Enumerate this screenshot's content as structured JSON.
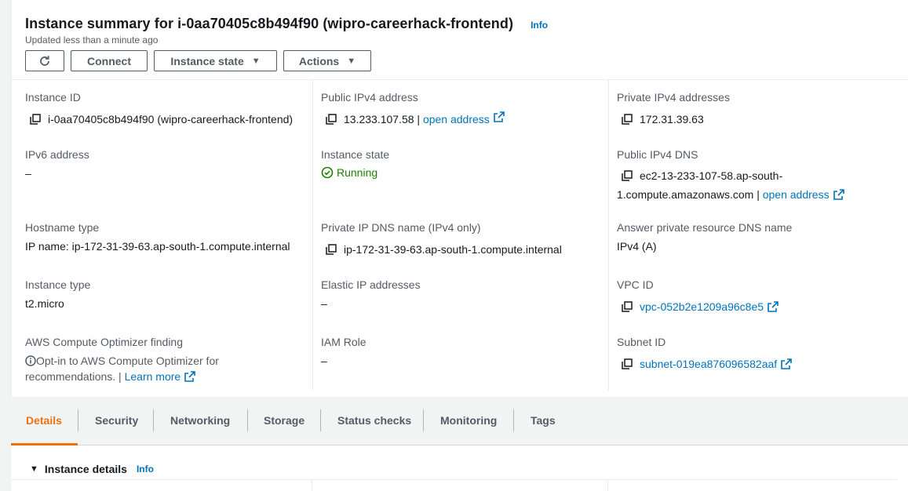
{
  "header": {
    "title": "Instance summary for i-0aa70405c8b494f90 (wipro-careerhack-frontend)",
    "info": "Info",
    "updated": "Updated less than a minute ago",
    "buttons": {
      "connect": "Connect",
      "instance_state": "Instance state",
      "actions": "Actions"
    }
  },
  "summary": {
    "instance_id": {
      "label": "Instance ID",
      "value": "i-0aa70405c8b494f90 (wipro-careerhack-frontend)"
    },
    "public_ipv4": {
      "label": "Public IPv4 address",
      "value": "13.233.107.58 |",
      "link": "open address"
    },
    "private_ipv4": {
      "label": "Private IPv4 addresses",
      "value": "172.31.39.63"
    },
    "ipv6": {
      "label": "IPv6 address",
      "value": "–"
    },
    "instance_state": {
      "label": "Instance state",
      "value": "Running"
    },
    "public_dns": {
      "label": "Public IPv4 DNS",
      "value_line1": "ec2-13-233-107-58.ap-south-",
      "value_line2": "1.compute.amazonaws.com |",
      "link": "open address"
    },
    "hostname_type": {
      "label": "Hostname type",
      "value": "IP name: ip-172-31-39-63.ap-south-1.compute.internal"
    },
    "private_dns": {
      "label": "Private IP DNS name (IPv4 only)",
      "value": "ip-172-31-39-63.ap-south-1.compute.internal"
    },
    "answer_dns": {
      "label": "Answer private resource DNS name",
      "value": "IPv4 (A)"
    },
    "instance_type": {
      "label": "Instance type",
      "value": "t2.micro"
    },
    "elastic_ip": {
      "label": "Elastic IP addresses",
      "value": "–"
    },
    "vpc_id": {
      "label": "VPC ID",
      "value": "vpc-052b2e1209a96c8e5"
    },
    "optimizer": {
      "label": "AWS Compute Optimizer finding",
      "text_line1": "Opt-in to AWS Compute Optimizer for",
      "text_line2": "recommendations. |",
      "link": "Learn more"
    },
    "iam_role": {
      "label": "IAM Role",
      "value": "–"
    },
    "subnet_id": {
      "label": "Subnet ID",
      "value": "subnet-019ea876096582aaf"
    }
  },
  "tabs": [
    "Details",
    "Security",
    "Networking",
    "Storage",
    "Status checks",
    "Monitoring",
    "Tags"
  ],
  "active_tab": "Details",
  "details": {
    "title": "Instance details",
    "info": "Info"
  },
  "colors": {
    "link": "#0073bb",
    "running": "#1d8102",
    "active_tab": "#ec7211"
  }
}
